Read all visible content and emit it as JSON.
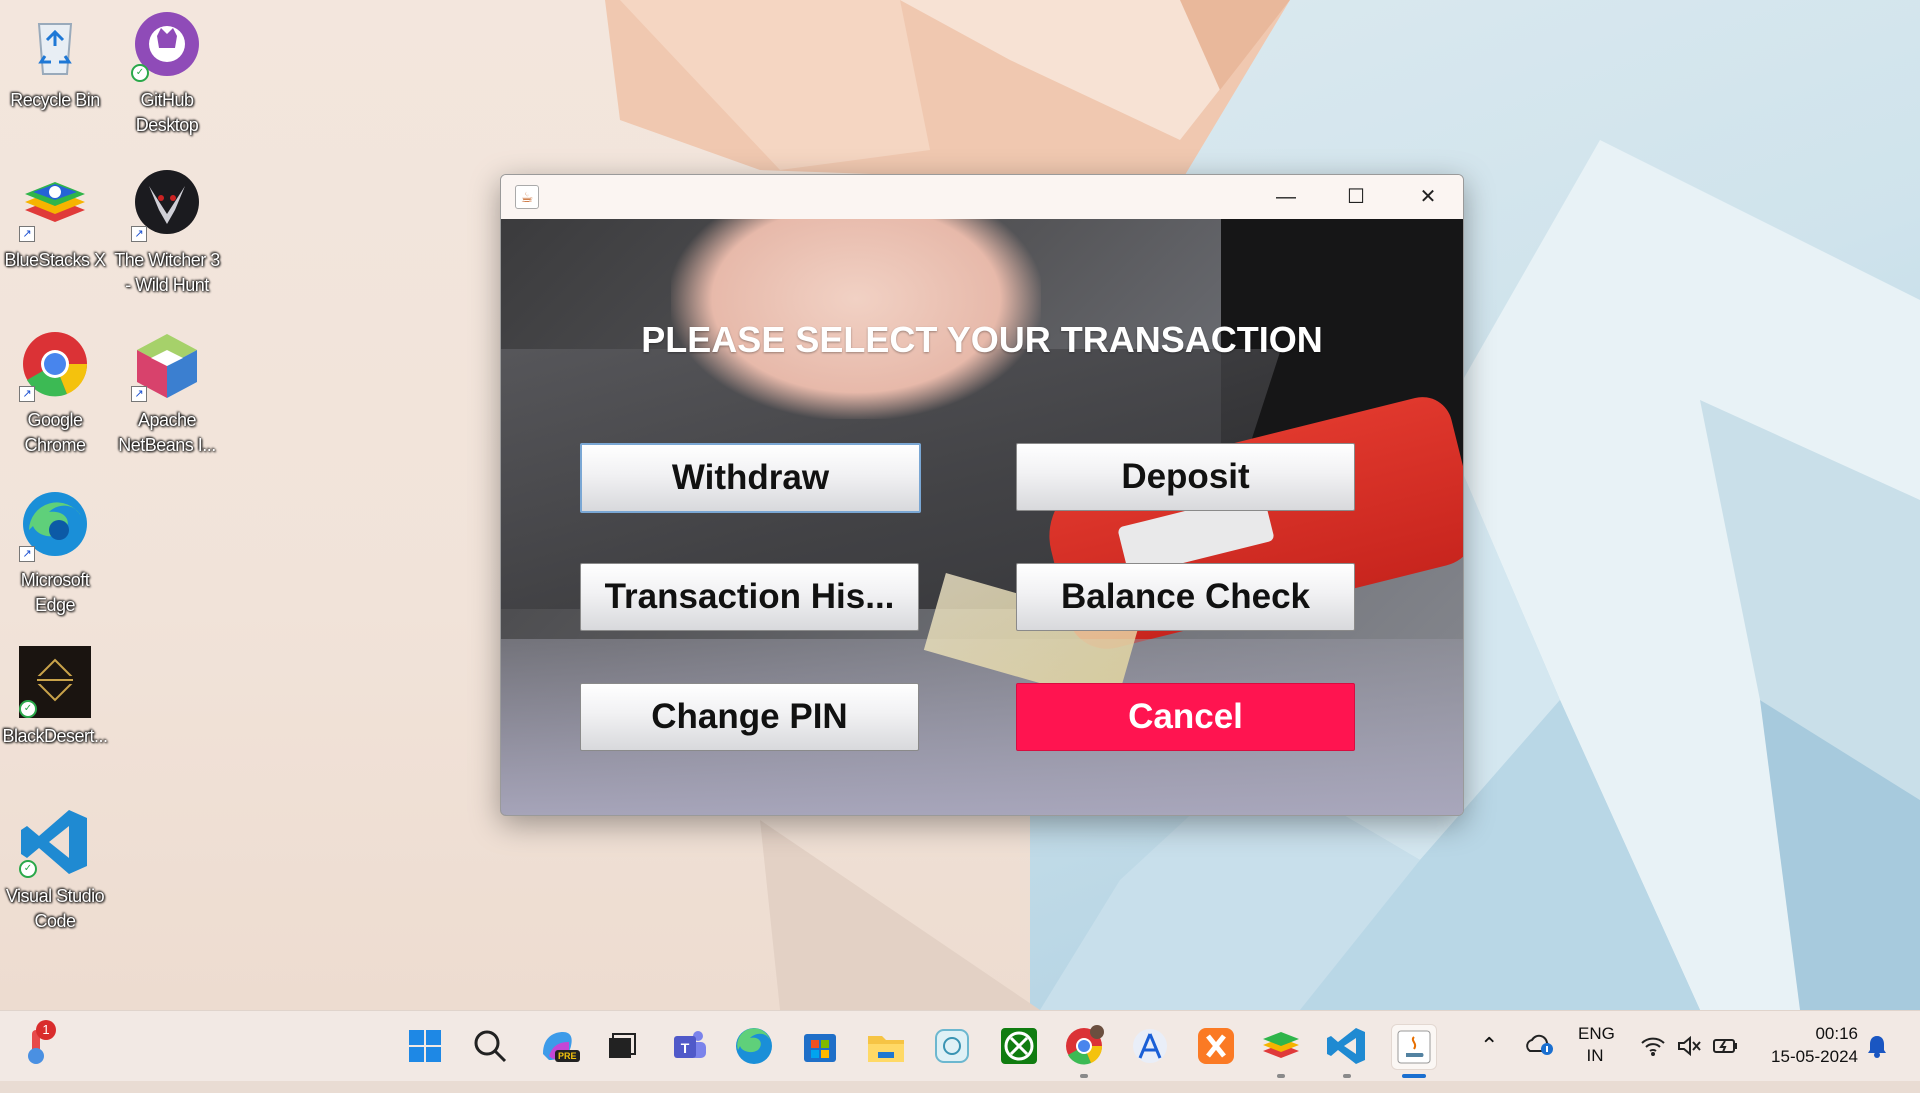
{
  "desktop": {
    "icons": [
      {
        "label1": "Recycle Bin",
        "label2": ""
      },
      {
        "label1": "GitHub",
        "label2": "Desktop"
      },
      {
        "label1": "BlueStacks X",
        "label2": ""
      },
      {
        "label1": "The Witcher 3",
        "label2": "- Wild Hunt"
      },
      {
        "label1": "Google",
        "label2": "Chrome"
      },
      {
        "label1": "Apache",
        "label2": "NetBeans I..."
      },
      {
        "label1": "Microsoft",
        "label2": "Edge"
      },
      {
        "label1": "BlackDesert...",
        "label2": ""
      },
      {
        "label1": "Visual Studio",
        "label2": "Code"
      }
    ]
  },
  "window": {
    "heading": "PLEASE SELECT YOUR TRANSACTION",
    "buttons": {
      "withdraw": "Withdraw",
      "deposit": "Deposit",
      "history": "Transaction His...",
      "balance": "Balance Check",
      "pin": "Change PIN",
      "cancel": "Cancel"
    },
    "title_controls": {
      "minimize": "—",
      "maximize": "☐",
      "close": "✕"
    },
    "colors": {
      "cancel_bg": "#ff1450",
      "heading": "#ffffff"
    }
  },
  "taskbar": {
    "weather_badge": "1",
    "copilot_badge": "PRE",
    "language_line1": "ENG",
    "language_line2": "IN",
    "time": "00:16",
    "date": "15-05-2024",
    "icons": [
      "start-icon",
      "search-icon",
      "copilot-icon",
      "task-view-icon",
      "teams-icon",
      "edge-icon",
      "store-icon",
      "file-explorer-icon",
      "app-icon",
      "xbox-icon",
      "chrome-icon",
      "app-store-icon",
      "xampp-icon",
      "bluestacks-icon",
      "vscode-icon",
      "java-icon"
    ]
  }
}
